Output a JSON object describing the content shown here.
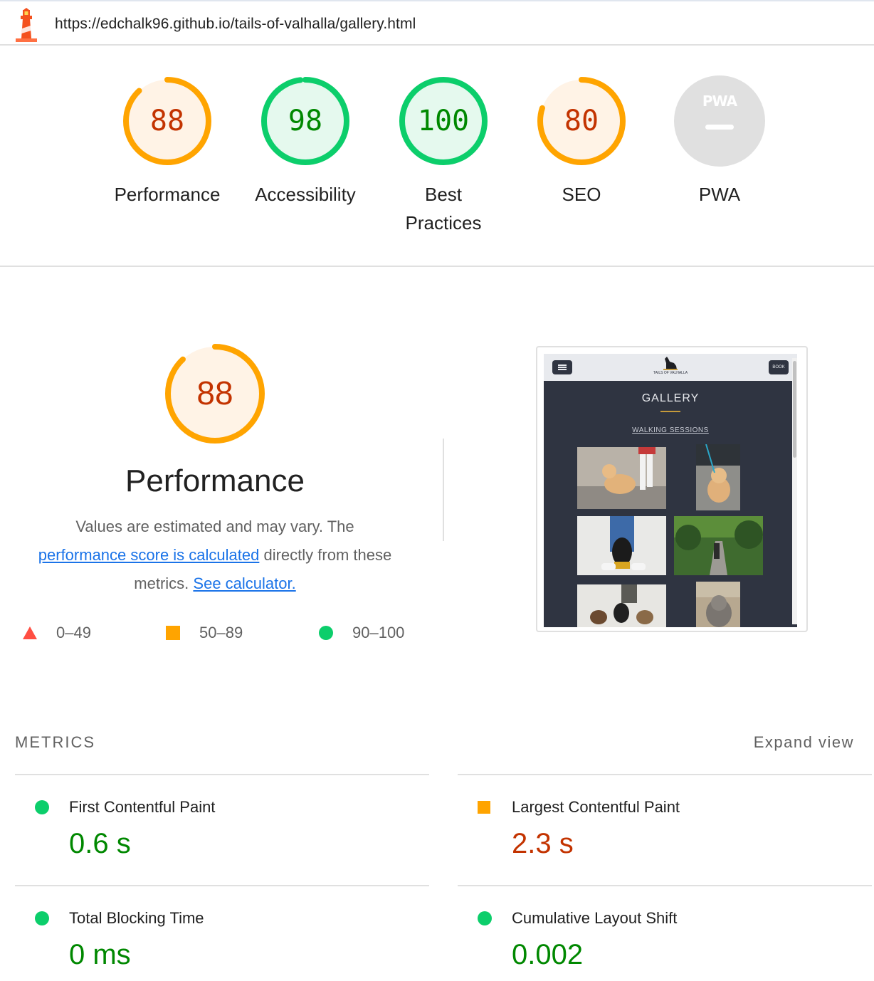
{
  "header": {
    "url": "https://edchalk96.github.io/tails-of-valhalla/gallery.html",
    "logo_icon": "lighthouse-icon"
  },
  "categories": [
    {
      "label_line1": "Performance",
      "label_line2": "",
      "score": "88",
      "fraction": 0.88,
      "status": "average"
    },
    {
      "label_line1": "Accessibility",
      "label_line2": "",
      "score": "98",
      "fraction": 0.98,
      "status": "pass"
    },
    {
      "label_line1": "Best",
      "label_line2": "Practices",
      "score": "100",
      "fraction": 1.0,
      "status": "pass"
    },
    {
      "label_line1": "SEO",
      "label_line2": "",
      "score": "80",
      "fraction": 0.8,
      "status": "average"
    },
    {
      "label_line1": "PWA",
      "label_line2": "",
      "badge_text": "PWA",
      "status": "na"
    }
  ],
  "performance": {
    "score": "88",
    "fraction": 0.88,
    "title": "Performance",
    "desc_part1": "Values are estimated and may vary. The",
    "desc_link": "performance score is calculated",
    "desc_part2": "directly from these",
    "desc_part3": "metrics.",
    "calc_link": "See calculator."
  },
  "legend": [
    {
      "range": "0–49",
      "shape": "triangle",
      "color": "#ff4e42"
    },
    {
      "range": "50–89",
      "shape": "square",
      "color": "#ffa400"
    },
    {
      "range": "90–100",
      "shape": "circle",
      "color": "#0cce6b"
    }
  ],
  "screenshot": {
    "heading": "GALLERY",
    "subheading": "WALKING SESSIONS",
    "brand": "TAILS OF VALHALLA",
    "book": "BOOK"
  },
  "metrics": {
    "heading": "METRICS",
    "expand": "Expand view",
    "items": [
      {
        "name": "First Contentful Paint",
        "value": "0.6 s",
        "status": "pass"
      },
      {
        "name": "Largest Contentful Paint",
        "value": "2.3 s",
        "status": "average"
      },
      {
        "name": "Total Blocking Time",
        "value": "0 ms",
        "status": "pass"
      },
      {
        "name": "Cumulative Layout Shift",
        "value": "0.002",
        "status": "pass"
      }
    ]
  },
  "colors": {
    "pass": "#0cce6b",
    "pass_text": "#008800",
    "pass_bg": "#e5f9ee",
    "average": "#ffa400",
    "average_text": "#c33300",
    "average_bg": "#fff3e6",
    "fail": "#ff4e42",
    "na_bg": "#e0e0e0",
    "na_fg": "#ffffff"
  }
}
